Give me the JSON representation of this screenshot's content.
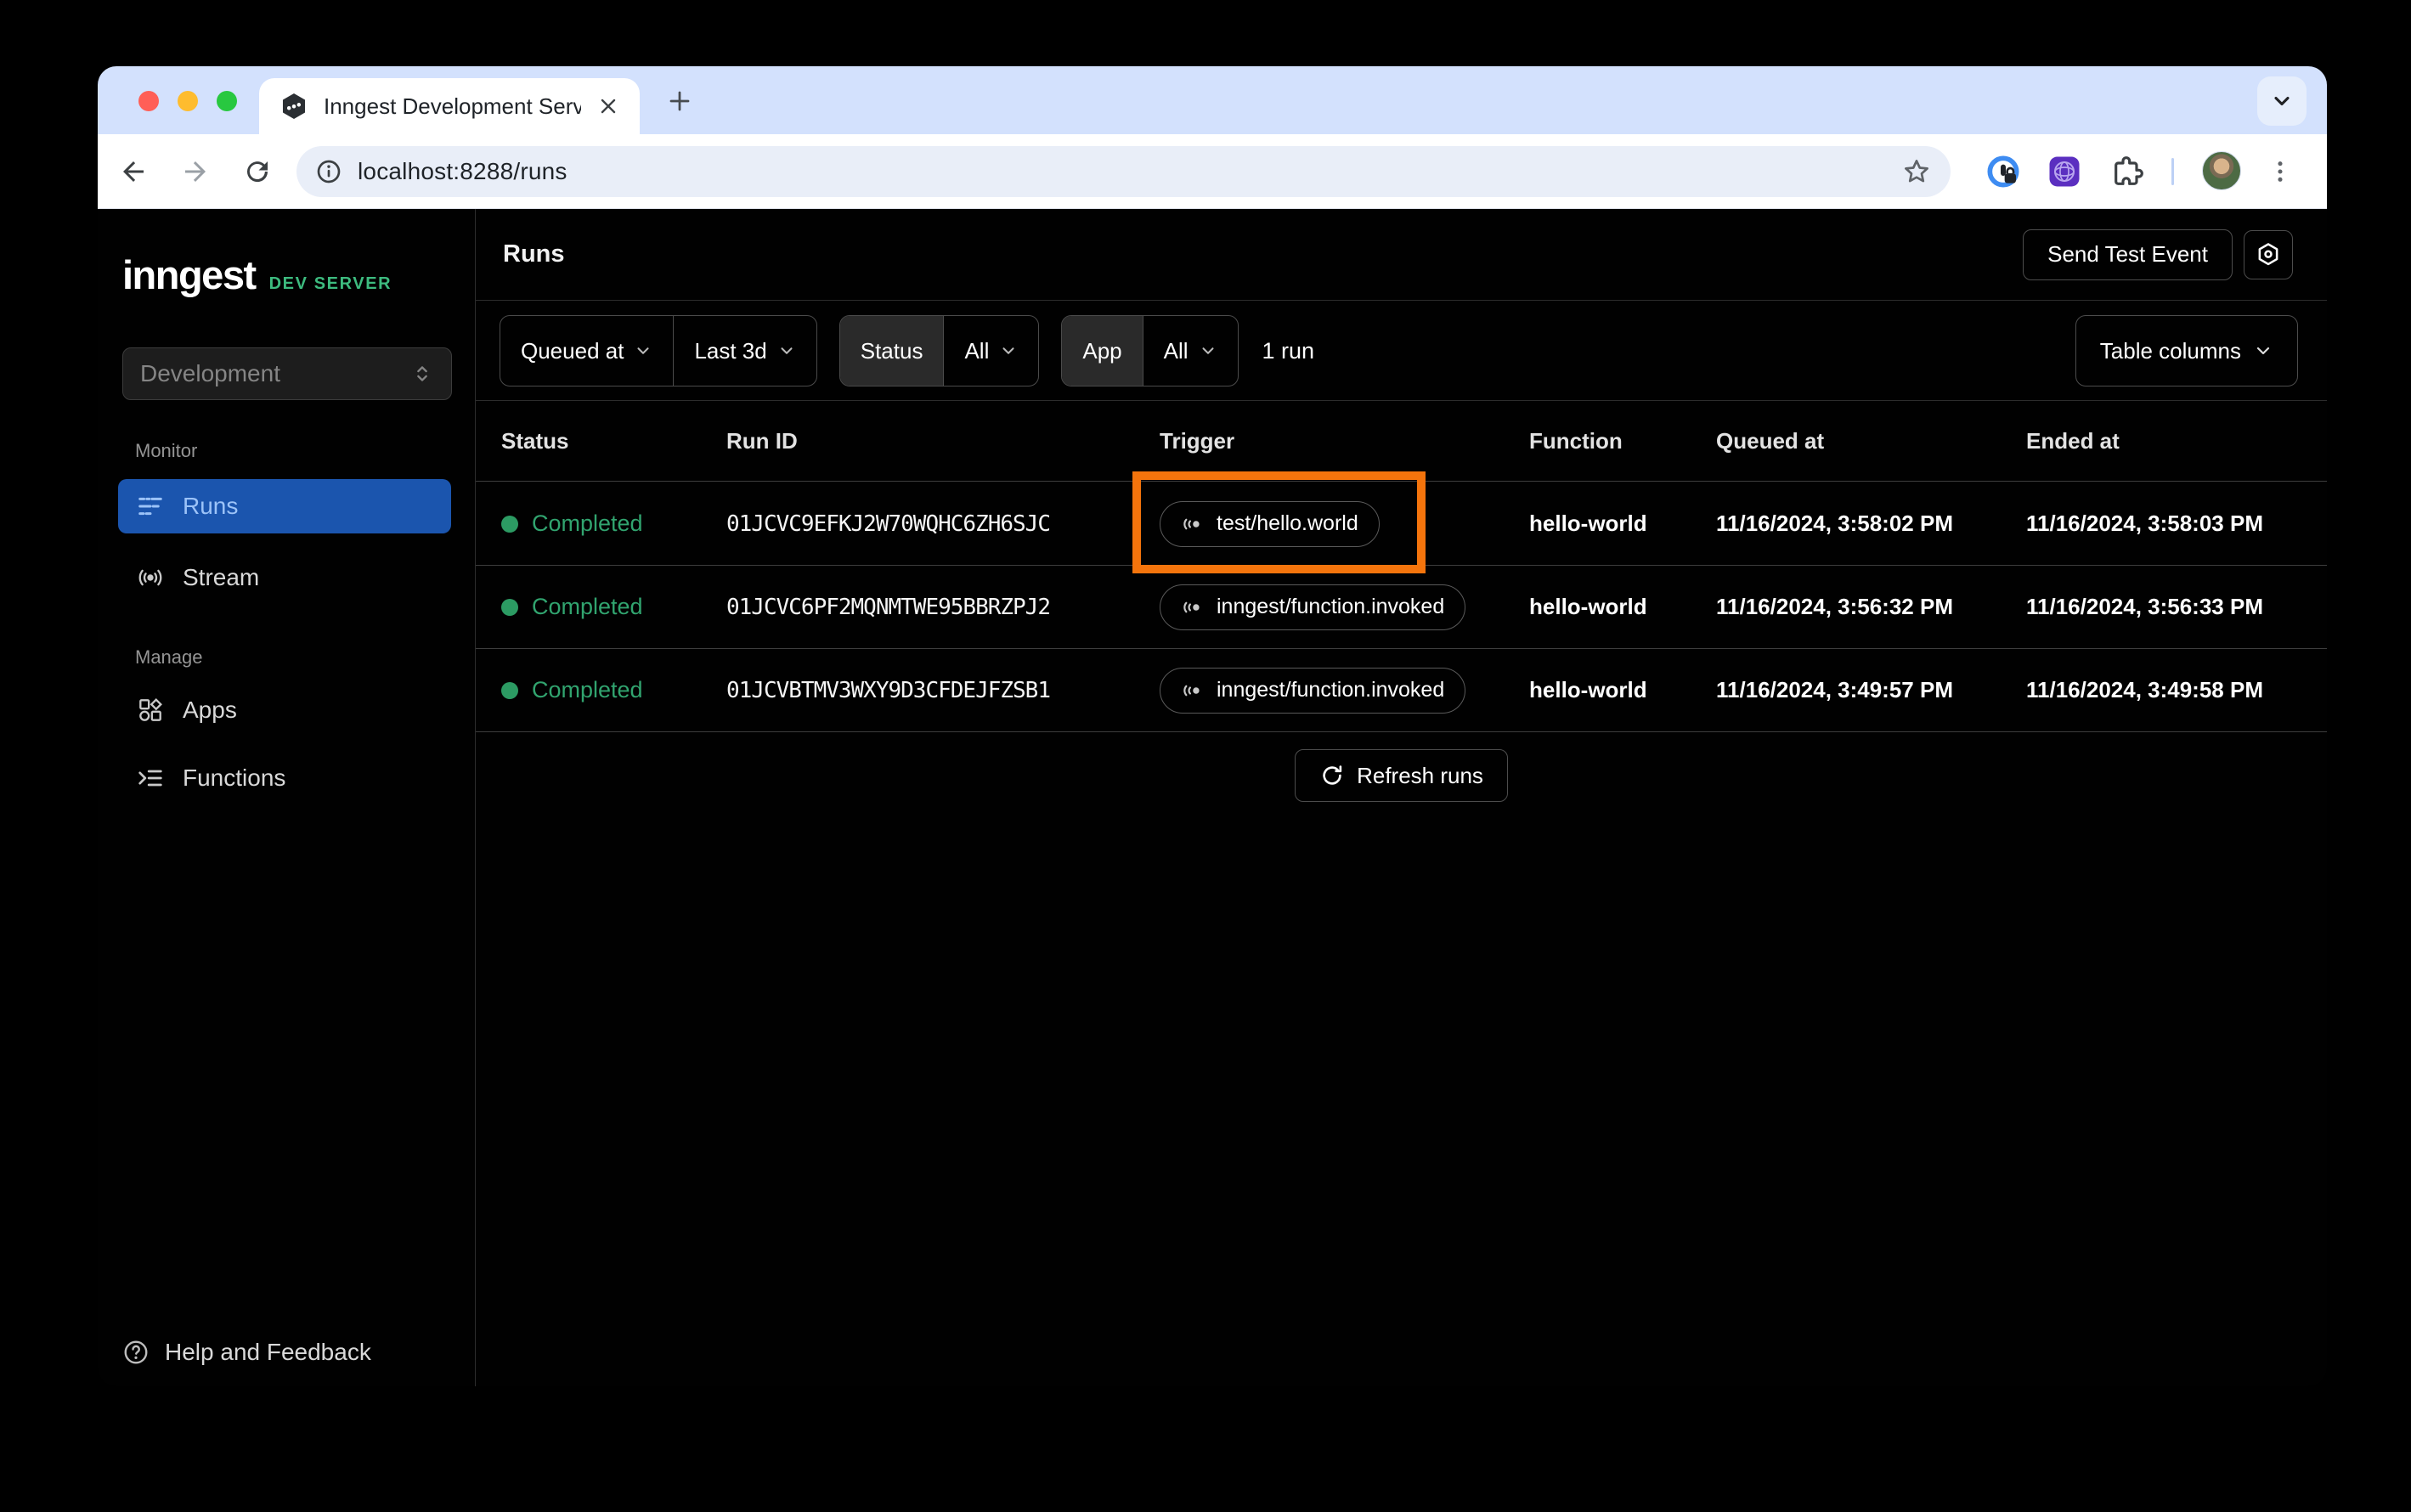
{
  "browser": {
    "tab_title": "Inngest Development Server",
    "url": "localhost:8288/runs"
  },
  "sidebar": {
    "logo": "inngest",
    "logo_badge": "DEV SERVER",
    "env_select": "Development",
    "section_monitor": "Monitor",
    "section_manage": "Manage",
    "items": {
      "runs": "Runs",
      "stream": "Stream",
      "apps": "Apps",
      "functions": "Functions"
    },
    "help": "Help and Feedback"
  },
  "header": {
    "title": "Runs",
    "send_test_event": "Send Test Event"
  },
  "filters": {
    "queued_at": "Queued at",
    "time_range": "Last 3d",
    "status_label": "Status",
    "status_value": "All",
    "app_label": "App",
    "app_value": "All",
    "run_count": "1 run",
    "table_columns": "Table columns"
  },
  "table": {
    "headers": [
      "Status",
      "Run ID",
      "Trigger",
      "Function",
      "Queued at",
      "Ended at"
    ],
    "rows": [
      {
        "status": "Completed",
        "run_id": "01JCVC9EFKJ2W70WQHC6ZH6SJC",
        "trigger": "test/hello.world",
        "function": "hello-world",
        "queued_at": "11/16/2024, 3:58:02 PM",
        "ended_at": "11/16/2024, 3:58:03 PM",
        "highlighted": true
      },
      {
        "status": "Completed",
        "run_id": "01JCVC6PF2MQNMTWE95BBRZPJ2",
        "trigger": "inngest/function.invoked",
        "function": "hello-world",
        "queued_at": "11/16/2024, 3:56:32 PM",
        "ended_at": "11/16/2024, 3:56:33 PM",
        "highlighted": false
      },
      {
        "status": "Completed",
        "run_id": "01JCVBTMV3WXY9D3CFDEJFZSB1",
        "trigger": "inngest/function.invoked",
        "function": "hello-world",
        "queued_at": "11/16/2024, 3:49:57 PM",
        "ended_at": "11/16/2024, 3:49:58 PM",
        "highlighted": false
      }
    ],
    "refresh": "Refresh runs"
  },
  "colors": {
    "highlight_orange": "#F4740C",
    "status_green": "#2C9B63",
    "selected_blue": "#1B55AE",
    "brand_green": "#3DBB7F",
    "tabstrip_blue": "#D3E1FD"
  }
}
